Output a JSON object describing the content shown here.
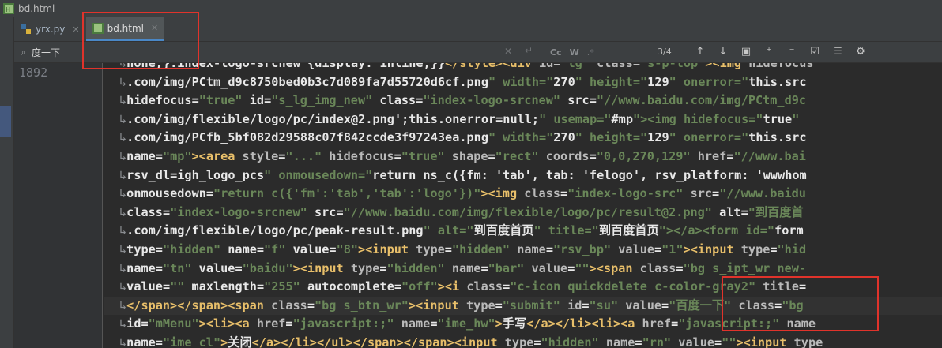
{
  "window": {
    "title": "bd.html"
  },
  "tabs": [
    {
      "label": "yrx.py",
      "active": false
    },
    {
      "label": "bd.html",
      "active": true
    }
  ],
  "find": {
    "query": "度一下",
    "match_count": "3/4",
    "case_toggle": "Cc",
    "word_toggle": "W",
    "regex_toggle": ".*"
  },
  "gutter": {
    "line_number": "1892"
  },
  "colors": {
    "tag": "#e8bf6a",
    "attr": "#bababa",
    "string": "#6a8759",
    "annotation": "#e0332b",
    "accent": "#4a88c7"
  },
  "code_lines": [
    "none;}.index-logo-srcnew {display: inline;}}</style><div id=\"lg\" class=\"s-p-top\"><img hidefocus",
    ".com/img/PCtm_d9c8750bed0b3c7d089fa7d55720d6cf.png\" width=\"270\" height=\"129\" onerror=\"this.src",
    "hidefocus=\"true\" id=\"s_lg_img_new\" class=\"index-logo-srcnew\" src=\"//www.baidu.com/img/PCtm_d9c",
    ".com/img/flexible/logo/pc/index@2.png';this.onerror=null;\" usemap=\"#mp\"><img hidefocus=\"true\" ",
    ".com/img/PCfb_5bf082d29588c07f842ccde3f97243ea.png\" width=\"270\" height=\"129\" onerror=\"this.src",
    "name=\"mp\"><area style=\"...\" hidefocus=\"true\" shape=\"rect\" coords=\"0,0,270,129\" href=\"//www.bai",
    "rsv_dl=igh_logo_pcs\" onmousedown=\"return ns_c({fm: 'tab', tab: 'felogo', rsv_platform: 'wwwhom",
    "onmousedown=\"return c({'fm':'tab','tab':'logo'})\"><img class=\"index-logo-src\" src=\"//www.baidu",
    "class=\"index-logo-srcnew\" src=\"//www.baidu.com/img/flexible/logo/pc/result@2.png\" alt=\"到百度首",
    ".com/img/flexible/logo/pc/peak-result.png\" alt=\"到百度首页\" title=\"到百度首页\"></a><form id=\"form",
    "type=\"hidden\" name=\"f\" value=\"8\"><input type=\"hidden\" name=\"rsv_bp\" value=\"1\"><input type=\"hid",
    "name=\"tn\" value=\"baidu\"><input type=\"hidden\" name=\"bar\" value=\"\"><span class=\"bg s_ipt_wr new-",
    "value=\"\" maxlength=\"255\" autocomplete=\"off\"><i class=\"c-icon quickdelete c-color-gray2\" title=",
    "</span></span><span class=\"bg s_btn_wr\"><input type=\"submit\" id=\"su\" value=\"百度一下\" class=\"bg",
    "id=\"mMenu\"><li><a href=\"javascript:;\" name=\"ime_hw\">手写</a></li><li><a href=\"javascript:;\" name",
    "name=\"ime_cl\">关闭</a></li></ul></span></span><input type=\"hidden\" name=\"rn\" value=\"\"><input type"
  ]
}
